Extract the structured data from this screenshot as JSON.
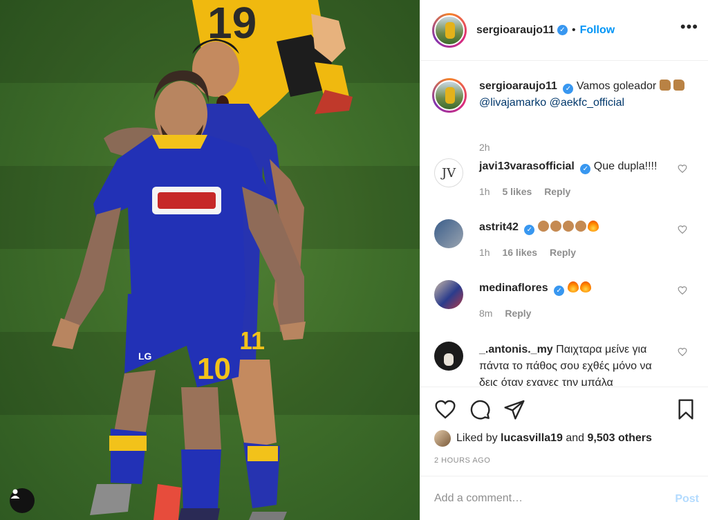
{
  "post": {
    "author": "sergioaraujo11",
    "follow_label": "Follow",
    "more_label": "•••",
    "separator": "•"
  },
  "caption": {
    "username": "sergioaraujo11",
    "text_1": "Vamos goleador",
    "mention_1": "@livajamarko",
    "mention_2": "@aekfc_official",
    "time": "2h"
  },
  "comments": [
    {
      "username": "javi13varasofficial",
      "verified": true,
      "text": "Que dupla!!!!",
      "time": "1h",
      "likes": "5 likes",
      "reply": "Reply"
    },
    {
      "username": "astrit42",
      "verified": true,
      "text": "",
      "time": "1h",
      "likes": "16 likes",
      "reply": "Reply"
    },
    {
      "username": "medinaflores",
      "verified": true,
      "text": "",
      "time": "8m",
      "reply": "Reply"
    },
    {
      "username": "_.antonis._my",
      "verified": false,
      "text": "Παιχταρα μείνε για πάντα το πάθος σου εχθές μόνο να δεις όταν εχανες την μπάλα"
    }
  ],
  "likes": {
    "prefix": "Liked by",
    "user": "lucasvilla19",
    "and": "and",
    "others": "9,503 others"
  },
  "timestamp": "2 HOURS AGO",
  "comment_box": {
    "placeholder": "Add a comment…",
    "post_label": "Post"
  },
  "jersey_numbers": {
    "back_player": "19",
    "front_player": "10",
    "second_player": "11"
  },
  "jersey_text": {
    "sponsor": "LG"
  },
  "colors": {
    "accent": "#0095f6",
    "post_disabled": "#b3dbff",
    "pitch": "#3f6e2a",
    "kit_blue": "#2231b6",
    "kit_yellow": "#f2c21a"
  },
  "icons": [
    "heart-icon",
    "comment-icon",
    "share-icon",
    "bookmark-icon",
    "person-tag-icon",
    "verified-badge-icon"
  ]
}
